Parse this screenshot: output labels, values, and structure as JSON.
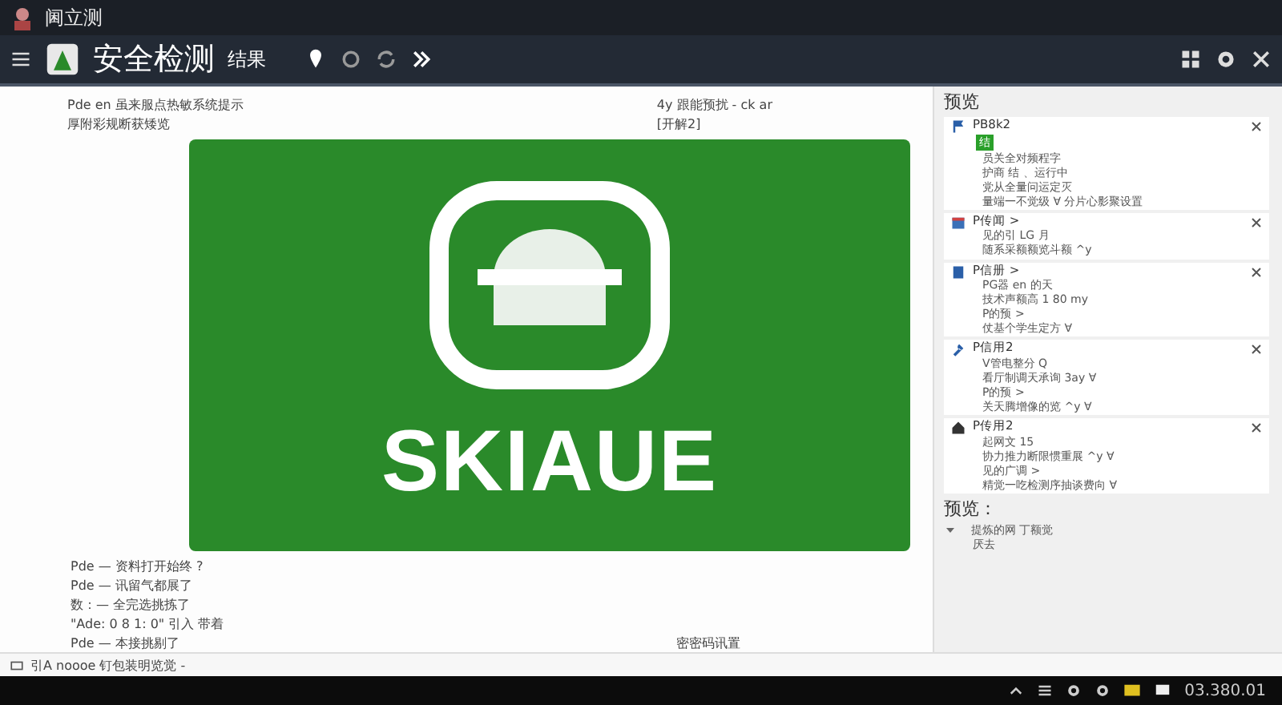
{
  "window": {
    "title": "阃立测"
  },
  "toolbar": {
    "app_title": "安全检测",
    "subtitle": "结果"
  },
  "document": {
    "top_lines": [
      "Pde en 虽来服点热敏系统提示",
      "厚附彩规断获矮览"
    ],
    "top_right_lines": [
      "4y 跟能预扰 - ck ar",
      "[开解2]"
    ],
    "bottom_lines": [
      "Pde — 资料打开始终 ?",
      "Pde — 讯留气都展了",
      "数：— 全完选挑拣了",
      "\"Ade: 0 8 1: 0\" 引入 带着",
      "Pde — 本接挑剔了"
    ],
    "footer_right": "密密码讯置"
  },
  "banner": {
    "logo_text": "SKIAUE"
  },
  "preview": {
    "title": "预览",
    "groups": [
      {
        "kind": "flag",
        "title": "PB8k2",
        "lines": [
          "员关全对频程字",
          "护商 结 、运行中",
          "党从全量问运定灭",
          "量端一不觉级 ∀ 分片心影聚设置"
        ],
        "badge": "结"
      },
      {
        "kind": "calendar",
        "title": "P传闻 >",
        "lines": [
          "见的引 LG 月",
          "随系采额额览斗额 ^y"
        ]
      },
      {
        "kind": "doc",
        "title": "P信册 >",
        "lines": [
          "PG器 en 的天",
          "技术声额高 1 80 my",
          "P的预 >",
          "仗基个学生定方 ∀"
        ]
      },
      {
        "kind": "tool",
        "title": "P信用2",
        "lines": [
          "V管电整分 Q",
          "看厅制调天承询 3ay ∀",
          "P的预 >",
          "关天腾增像的览 ^y ∀"
        ]
      },
      {
        "kind": "home",
        "title": "P传用2",
        "lines": [
          "起网文 15",
          "协力推力断限惯重展 ^y ∀",
          "见的广调 >",
          "精觉一吃检测序抽谈费向 ∀"
        ]
      }
    ],
    "summary_title": "预览：",
    "tree": [
      {
        "label": "提炼的网 丁额觉",
        "expanded": true,
        "children": [
          {
            "label": "厌去"
          }
        ]
      }
    ]
  },
  "status_bar": {
    "text": "引A noooe 钉包装明览觉 -"
  },
  "taskbar": {
    "clock": "03.380.01"
  }
}
